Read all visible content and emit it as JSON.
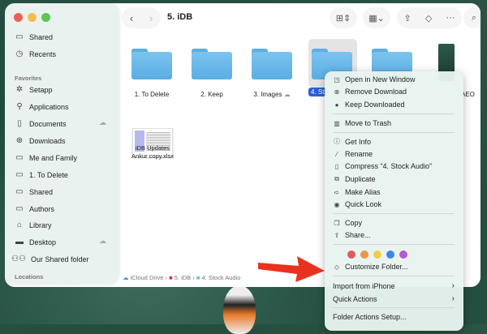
{
  "window": {
    "title": "5. iDB"
  },
  "sidebar": {
    "top": [
      {
        "label": "Shared",
        "icon": "shared-folder-icon"
      },
      {
        "label": "Recents",
        "icon": "clock-icon"
      }
    ],
    "favorites_heading": "Favorites",
    "favorites": [
      {
        "label": "Setapp",
        "icon": "setapp-icon"
      },
      {
        "label": "Applications",
        "icon": "applications-icon"
      },
      {
        "label": "Documents",
        "icon": "document-icon",
        "cloud": true
      },
      {
        "label": "Downloads",
        "icon": "download-icon"
      },
      {
        "label": "Me and Family",
        "icon": "folder-icon"
      },
      {
        "label": "1. To Delete",
        "icon": "folder-icon"
      },
      {
        "label": "Shared",
        "icon": "folder-icon"
      },
      {
        "label": "Authors",
        "icon": "folder-icon"
      },
      {
        "label": "Library",
        "icon": "library-icon"
      },
      {
        "label": "Desktop",
        "icon": "desktop-icon",
        "cloud": true
      },
      {
        "label": "Our Shared folder",
        "icon": "people-icon"
      }
    ],
    "locations_heading": "Locations"
  },
  "files": [
    {
      "name": "1. To Delete"
    },
    {
      "name": "2. Keep"
    },
    {
      "name": "3. Images"
    },
    {
      "name": "4. Stock Audio",
      "selected_label": "4. St"
    },
    {
      "name": "",
      "partial": true
    },
    {
      "name": "AEO",
      "partial": true
    },
    {
      "name_line1": "iDB Updates",
      "name_line2": "Ankur copy.xlsx"
    }
  ],
  "pathbar": [
    "iCloud Drive",
    "5. iDB",
    "4. Stock Audio"
  ],
  "context_menu": {
    "items": [
      {
        "label": "Open in New Window",
        "icon": "open-window-icon"
      },
      {
        "label": "Remove Download",
        "icon": "remove-circle-icon"
      },
      {
        "label": "Keep Downloaded",
        "icon": "download-filled-icon"
      },
      {
        "label": "Move to Trash",
        "icon": "trash-icon"
      },
      {
        "label": "Get Info",
        "icon": "info-icon"
      },
      {
        "label": "Rename",
        "icon": "pencil-icon"
      },
      {
        "label": "Compress “4. Stock Audio”",
        "icon": "archive-icon"
      },
      {
        "label": "Duplicate",
        "icon": "duplicate-icon"
      },
      {
        "label": "Make Alias",
        "icon": "alias-arrow-icon"
      },
      {
        "label": "Quick Look",
        "icon": "eye-icon"
      },
      {
        "label": "Copy",
        "icon": "copy-icon"
      },
      {
        "label": "Share...",
        "icon": "share-icon"
      },
      {
        "label": "Customize Folder...",
        "icon": "tag-icon"
      },
      {
        "label": "Import from iPhone"
      },
      {
        "label": "Quick Actions"
      },
      {
        "label": "Folder Actions Setup..."
      }
    ],
    "tag_colors": [
      "#e05a5a",
      "#e8964a",
      "#f0cc48",
      "#3d86e8",
      "#b45ad6"
    ]
  },
  "colors": {
    "selection": "#2a5fd6",
    "arrow": "#e8321e",
    "folder": "#6bb8ea"
  }
}
